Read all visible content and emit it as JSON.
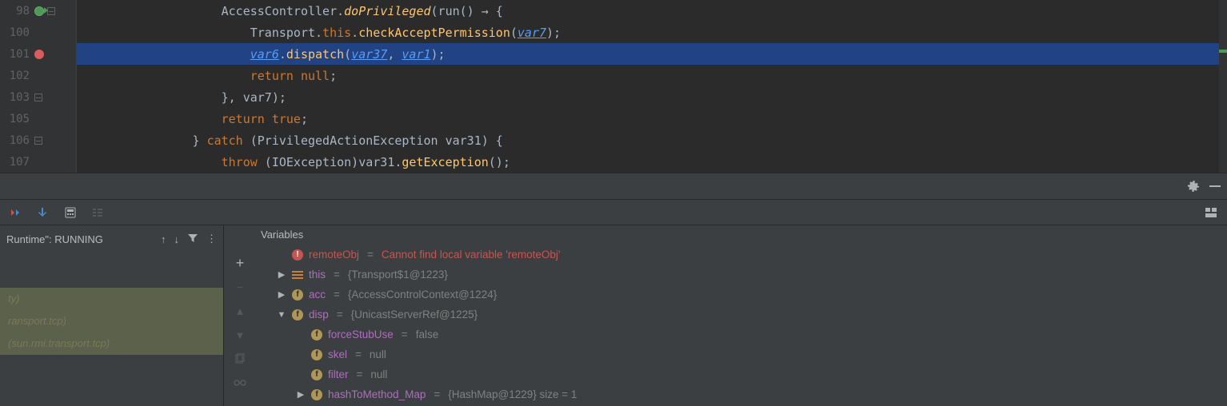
{
  "editor": {
    "lines": [
      {
        "n": "98",
        "marks": [
          "green",
          "fold"
        ],
        "segs": [
          [
            "cls",
            "                    AccessController."
          ],
          [
            "fn",
            "doPrivileged"
          ],
          [
            "pun",
            "("
          ],
          [
            "cls",
            "run() "
          ],
          [
            "pun",
            "→ {"
          ]
        ]
      },
      {
        "n": "100",
        "marks": [],
        "segs": [
          [
            "cls",
            "                        Transport."
          ],
          [
            "kw",
            "this"
          ],
          [
            "cls",
            "."
          ],
          [
            "fn-plain",
            "checkAcceptPermission"
          ],
          [
            "pun",
            "("
          ],
          [
            "lnk",
            "var7"
          ],
          [
            "pun",
            ");"
          ]
        ]
      },
      {
        "n": "101",
        "marks": [
          "bp"
        ],
        "hl": true,
        "segs": [
          [
            "cls",
            "                        "
          ],
          [
            "lnk",
            "var6"
          ],
          [
            "cls",
            "."
          ],
          [
            "fn-plain",
            "dispatch"
          ],
          [
            "pun",
            "("
          ],
          [
            "lnk",
            "var37"
          ],
          [
            "pun",
            ", "
          ],
          [
            "lnk",
            "var1"
          ],
          [
            "pun",
            ");"
          ]
        ]
      },
      {
        "n": "102",
        "marks": [],
        "segs": [
          [
            "cls",
            "                        "
          ],
          [
            "kw",
            "return "
          ],
          [
            "null",
            "null"
          ],
          [
            "pun",
            ";"
          ]
        ]
      },
      {
        "n": "103",
        "marks": [
          "fold"
        ],
        "segs": [
          [
            "cls",
            "                    "
          ],
          [
            "pun",
            "}"
          ],
          [
            "cls",
            ", var7);"
          ]
        ]
      },
      {
        "n": "105",
        "marks": [],
        "segs": [
          [
            "cls",
            "                    "
          ],
          [
            "kw",
            "return "
          ],
          [
            "null",
            "true"
          ],
          [
            "pun",
            ";"
          ]
        ]
      },
      {
        "n": "106",
        "marks": [
          "fold"
        ],
        "segs": [
          [
            "cls",
            "                } "
          ],
          [
            "kw",
            "catch"
          ],
          [
            "cls",
            " (PrivilegedActionException var31) {"
          ]
        ]
      },
      {
        "n": "107",
        "marks": [],
        "segs": [
          [
            "cls",
            "                    "
          ],
          [
            "kw",
            "throw"
          ],
          [
            "cls",
            " (IOException)var31."
          ],
          [
            "fn-plain",
            "getException"
          ],
          [
            "pun",
            "();"
          ]
        ]
      }
    ]
  },
  "midbar": {},
  "frames": {
    "status": "Runtime\": RUNNING",
    "items": [
      {
        "text": "",
        "sel": true,
        "spacer": true
      },
      {
        "text": "ty)"
      },
      {
        "text": "ransport.tcp)"
      },
      {
        "text": "(sun.rmi.transport.tcp)"
      }
    ]
  },
  "variables": {
    "title": "Variables",
    "rows": [
      {
        "depth": 1,
        "arrow": "",
        "icon": "err",
        "name": "remoteObj",
        "nameCls": "err",
        "eq": " = ",
        "val": "Cannot find local variable 'remoteObj'",
        "valCls": "err"
      },
      {
        "depth": 1,
        "arrow": "▶",
        "icon": "eq",
        "name": "this",
        "nameCls": "",
        "eq": " = ",
        "val": "{Transport$1@1223}",
        "valCls": ""
      },
      {
        "depth": 1,
        "arrow": "▶",
        "icon": "f",
        "name": "acc",
        "nameCls": "",
        "eq": " = ",
        "val": "{AccessControlContext@1224}",
        "valCls": ""
      },
      {
        "depth": 1,
        "arrow": "▼",
        "icon": "f",
        "name": "disp",
        "nameCls": "",
        "eq": " = ",
        "val": "{UnicastServerRef@1225}",
        "valCls": ""
      },
      {
        "depth": 2,
        "arrow": "",
        "icon": "f",
        "name": "forceStubUse",
        "nameCls": "child",
        "eq": " = ",
        "val": "false",
        "valCls": "lit"
      },
      {
        "depth": 2,
        "arrow": "",
        "icon": "f",
        "name": "skel",
        "nameCls": "child",
        "eq": " = ",
        "val": "null",
        "valCls": "lit"
      },
      {
        "depth": 2,
        "arrow": "",
        "icon": "f",
        "name": "filter",
        "nameCls": "child",
        "eq": " = ",
        "val": "null",
        "valCls": "lit"
      },
      {
        "depth": 2,
        "arrow": "▶",
        "icon": "f",
        "name": "hashToMethod_Map",
        "nameCls": "child",
        "eq": " = ",
        "val": "{HashMap@1229}  size = 1",
        "valCls": ""
      }
    ]
  }
}
